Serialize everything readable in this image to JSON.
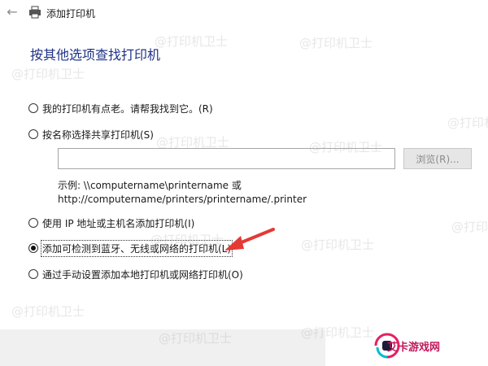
{
  "titlebar": {
    "title": "添加打印机"
  },
  "heading": "按其他选项查找打印机",
  "options": [
    {
      "label": "我的打印机有点老。请帮我找到它。(R)",
      "checked": false
    },
    {
      "label": "按名称选择共享打印机(S)",
      "checked": false
    },
    {
      "label": "使用 IP 地址或主机名添加打印机(I)",
      "checked": false
    },
    {
      "label": "添加可检测到蓝牙、无线或网络的打印机(L)",
      "checked": true
    },
    {
      "label": "通过手动设置添加本地打印机或网络打印机(O)",
      "checked": false
    }
  ],
  "shared_printer": {
    "input_value": "",
    "browse_label": "浏览(R)...",
    "example_line1": "示例: \\\\computername\\printername 或",
    "example_line2": "http://computername/printers/printername/.printer"
  },
  "watermark": "@打印机卫士",
  "logo_text": "艾卡游戏网",
  "colors": {
    "heading": "#1e3287",
    "arrow": "#e53935"
  }
}
